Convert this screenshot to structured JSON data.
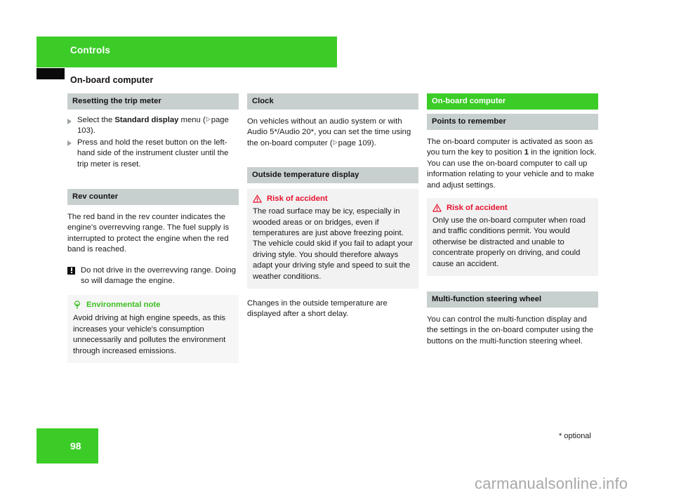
{
  "chapter": {
    "banner_title": "Controls",
    "page_heading": "On-board computer"
  },
  "colors": {
    "brand_green": "#3ccc28",
    "header_gray": "#c8cfcf",
    "warning_red": "#e8112d",
    "note_green": "#3cbf20",
    "black_tab": "#0b0b0b"
  },
  "columns": {
    "left": {
      "section_trip": {
        "header": "Resetting the trip meter",
        "steps": [
          {
            "pre": "Select the ",
            "bold": "Standard display",
            "post": " menu (",
            "ref": "page 103).",
            "icon": "ref-arrow-icon"
          },
          {
            "text": "Press and hold the reset button on the left-hand side of the instrument cluster until the trip meter is reset."
          }
        ]
      },
      "section_rev": {
        "header": "Rev counter",
        "paragraph": "The red band in the rev counter indicates the engine's overrevving range. The fuel supply is interrupted to protect the engine when the red band is reached.",
        "warning": {
          "icon": "warning-square-icon",
          "text": "Do not drive in the overrevving range. Doing so will damage the engine."
        },
        "eco_note": {
          "icon": "tree-icon",
          "title": "Environmental note",
          "body": "Avoid driving at high engine speeds, as this increases your vehicle's consumption unnecessarily and pollutes the environment through increased emissions."
        }
      }
    },
    "middle": {
      "section_clock": {
        "header": "Clock",
        "paragraph_pre": "On vehicles without an audio system or with Audio 5*/Audio 20*, you can set the time using the on-board computer (",
        "paragraph_ref": "page 109).",
        "ref_icon": "ref-arrow-icon"
      },
      "section_temp": {
        "header": "Outside temperature display",
        "risk": {
          "icon": "warning-triangle-icon",
          "title": "Risk of accident",
          "body": "The road surface may be icy, especially in wooded areas or on bridges, even if temperatures are just above freezing point. The vehicle could skid if you fail to adapt your driving style. You should therefore always adapt your driving style and speed to suit the weather conditions."
        },
        "paragraph": "Changes in the outside temperature are displayed after a short delay."
      }
    },
    "right": {
      "section_obc": {
        "header": "On-board computer",
        "sub_header": "Points to remember",
        "paragraph_pre": "The on-board computer is activated as soon as you turn the key to position ",
        "paragraph_bold": "1",
        "paragraph_post": " in the ignition lock. You can use the on-board computer to call up information relating to your vehicle and to make and adjust settings.",
        "risk": {
          "icon": "warning-triangle-icon",
          "title": "Risk of accident",
          "body": "Only use the on-board computer when road and traffic conditions permit. You would otherwise be distracted and unable to concentrate properly on driving, and could cause an accident."
        }
      },
      "section_mfsw": {
        "header": "Multi-function steering wheel",
        "paragraph": "You can control the multi-function display and the settings in the on-board computer using the buttons on the multi-function steering wheel."
      }
    }
  },
  "footer": {
    "page_number": "98",
    "footnote": "* optional",
    "watermark": "carmanualsonline.info"
  }
}
